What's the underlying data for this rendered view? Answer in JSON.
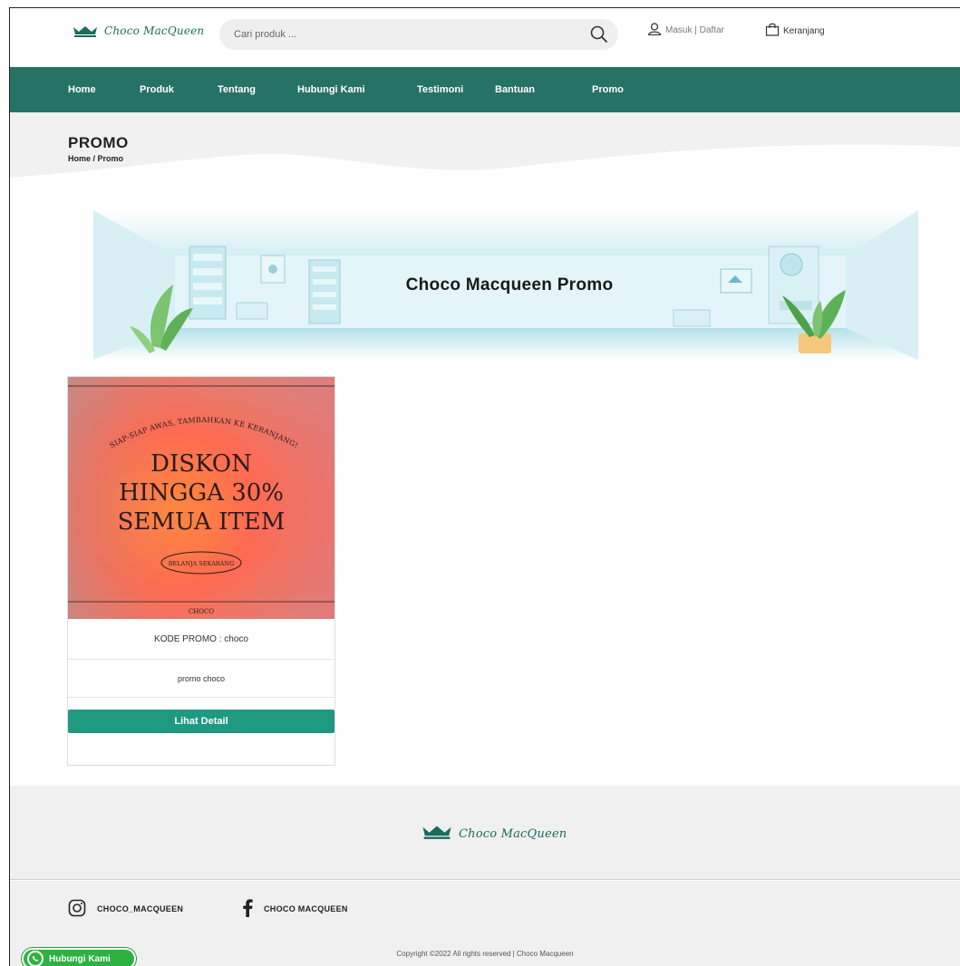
{
  "brand": {
    "name": "Choco MacQueen",
    "accent": "#267265"
  },
  "search": {
    "placeholder": "Cari produk ..."
  },
  "header": {
    "account_label": "Masuk | Daftar",
    "cart_label": "Keranjang"
  },
  "nav": {
    "items": [
      "Home",
      "Produk",
      "Tentang",
      "Hubungi Kami",
      "Testimoni",
      "Bantuan",
      "Promo"
    ]
  },
  "page": {
    "title": "PROMO",
    "breadcrumb": "Home / Promo"
  },
  "banner": {
    "title": "Choco Macqueen Promo"
  },
  "promo_card": {
    "image": {
      "arc_text": "SIAP-SIAP AWAS, TAMBAHKAN KE KERANJANG!",
      "line1": "DISKON",
      "line2": "HINGGA 30%",
      "line3": "SEMUA ITEM",
      "cta": "BELANJA SEKARANG",
      "brand": "CHOCO"
    },
    "code_label": "KODE PROMO : choco",
    "description": "promo choco",
    "button_label": "Lihat Detail"
  },
  "footer": {
    "instagram": "CHOCO_MACQUEEN",
    "facebook": "CHOCO MACQUEEN",
    "copyright": "Copyright ©2022 All rights reserved | Choco Macqueen",
    "whatsapp_label": "Hubungi Kami"
  }
}
